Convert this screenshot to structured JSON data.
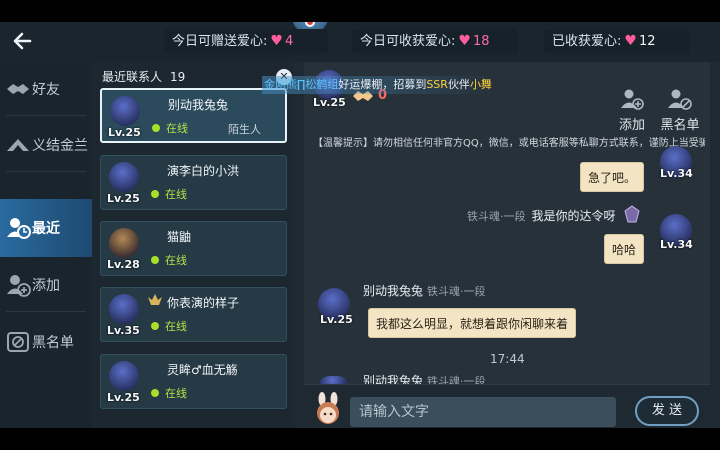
{
  "topbar": {
    "stats": [
      {
        "label": "今日可赠送爱心:",
        "value": "4"
      },
      {
        "label": "今日可收获爱心:",
        "value": "18"
      },
      {
        "label": "已收获爱心:",
        "value": "12"
      }
    ]
  },
  "sidebar": {
    "items": [
      {
        "label": "好友",
        "icon": "handshake-icon"
      },
      {
        "label": "义结金兰",
        "icon": "alliance-icon"
      },
      {
        "label": "最近",
        "icon": "recent-user-clock-icon"
      },
      {
        "label": "添加",
        "icon": "add-user-icon"
      },
      {
        "label": "黑名单",
        "icon": "block-user-icon"
      }
    ]
  },
  "contacts": {
    "title": "最近联系人",
    "count": "19",
    "items": [
      {
        "name": "别动我兔兔",
        "status": "在线",
        "tag": "陌生人",
        "level": "Lv.25"
      },
      {
        "name": "演李白的小洪",
        "status": "在线",
        "tag": "",
        "level": "Lv.25"
      },
      {
        "name": "猫鼬",
        "status": "在线",
        "tag": "",
        "level": "Lv.28"
      },
      {
        "name": "你表演的样子",
        "status": "在线",
        "tag": "",
        "level": "Lv.35"
      },
      {
        "name": "灵眸♂血无觞",
        "status": "在线",
        "tag": "",
        "level": "Lv.25"
      }
    ]
  },
  "banner": {
    "pre": "金刚熊∏松鹤组",
    "mid": "好运爆棚，招募到",
    "rarity": "SSR",
    "mid2": "伙伴",
    "partner": "小舞"
  },
  "chat": {
    "header_level": "Lv.25",
    "header_count": "0",
    "hint": "【温馨提示】请勿相信任何非官方QQ，微信，或电话客服等私聊方式联系，谨防上当受骗!",
    "messages": [
      {
        "text": "急了吧。",
        "level": "Lv.34"
      },
      {
        "sender": "我是你的达令呀",
        "rank": "铁斗魂·一段",
        "text": "哈哈",
        "level": "Lv.34"
      },
      {
        "sender": "别动我兔兔",
        "rank": "铁斗魂·一段",
        "text": "我都这么明显，就想着跟你闲聊来着",
        "level": "Lv.25"
      },
      {
        "sender": "别动我兔兔",
        "rank": "铁斗魂·一段"
      }
    ],
    "timestamp": "17:44",
    "actions": [
      {
        "label": "添加",
        "icon": "add-friend-icon"
      },
      {
        "label": "黑名单",
        "icon": "blacklist-icon"
      }
    ]
  },
  "composer": {
    "placeholder": "请输入文字",
    "send_label": "发 送"
  },
  "colors": {
    "accent": "#2a6aa0",
    "online": "#a6e02a",
    "heart": "#ff5e9a",
    "bubble": "#f3e5c4"
  }
}
